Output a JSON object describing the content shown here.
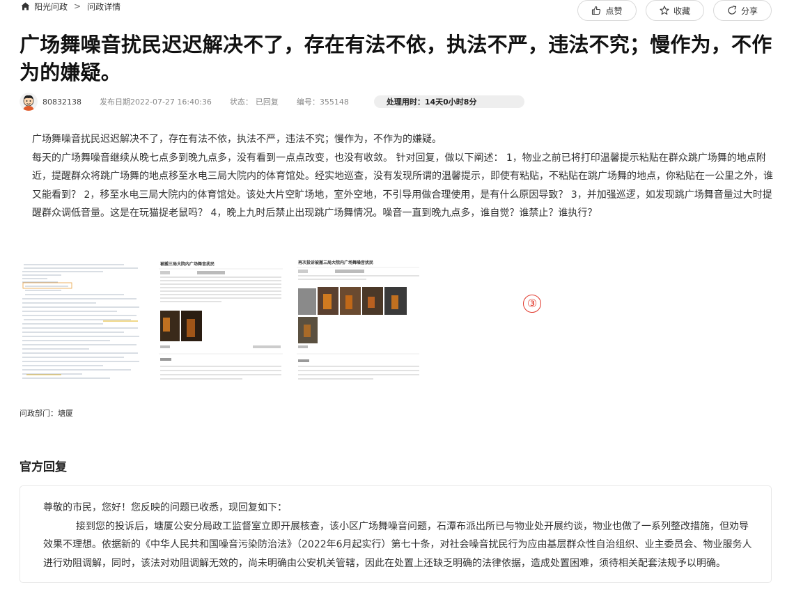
{
  "breadcrumb": {
    "home_icon": "home-icon",
    "home": "阳光问政",
    "separator": ">",
    "current": "问政详情"
  },
  "title": "广场舞噪音扰民迟迟解决不了，存在有法不依，执法不严，违法不究；慢作为，不作为的嫌疑。",
  "meta": {
    "user": "80832138",
    "date": "发布日期2022-07-27 16:40:36",
    "status_label": "状态：",
    "status_value": "已回复",
    "number": "编号：355148",
    "duration": "处理用时：14天0小时8分"
  },
  "content": {
    "paragraph1": "广场舞噪音扰民迟迟解决不了，存在有法不依，执法不严，违法不究；慢作为，不作为的嫌疑。",
    "paragraph2": "每天的广场舞噪音继续从晚七点多到晚九点多，没有看到一点点改变，也没有收敛。 针对回复，做以下阐述： 1，物业之前已将打印温馨提示粘贴在群众跳广场舞的地点附近，提醒群众将跳广场舞的地点移至水电三局大院内的体育馆处。经实地巡查，没有发现所谓的温馨提示，即使有粘贴，不粘贴在跳广场舞的地点，你粘贴在一公里之外，谁又能看到？ 2，移至水电三局大院内的体育馆处。该处大片空旷场地，室外空地，不引导用做合理使用，是有什么原因导致？ 3，并加强巡逻，如发现跳广场舞音量过大时提醒群众调低音量。这是在玩猫捉老鼠吗？ 4，晚上九时后禁止出现跳广场舞情况。噪音一直到晚九点多，谁自觉？谁禁止？谁执行？"
  },
  "images": {
    "shot2_title": "被搬三局大院内广场舞音扰民",
    "shot3_title": "再次投诉被搬三局大院内广场舞噪音扰民"
  },
  "marker": "③",
  "dept": "问政部门：塘厦",
  "actions": {
    "like": "点赞",
    "favorite": "收藏",
    "share": "分享"
  },
  "reply": {
    "section_title": "官方回复",
    "greeting": "尊敬的市民，您好！您反映的问题已收悉，现回复如下：",
    "body": "接到您的投诉后，塘厦公安分局政工监督室立即开展核查，该小区广场舞噪音问题，石潭布派出所已与物业处开展约谈，物业也做了一系列整改措施，但劝导效果不理想。依据新的《中华人民共和国噪音污染防治法》（2022年6月起实行）第七十条，对社会噪音扰民行为应由基层群众性自治组织、业主委员会、物业服务人进行劝阻调解，同时，该法对劝阻调解无效的，尚未明确由公安机关管辖，因此在处置上还缺乏明确的法律依据，造成处置困难，须待相关配套法规予以明确。"
  },
  "colors": {
    "marker": "#e1372b",
    "duration_bg": "#eeeeee",
    "border": "#d9d9d9"
  }
}
